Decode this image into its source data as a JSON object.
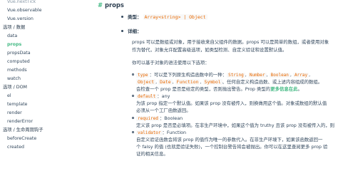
{
  "sidebar": {
    "items": [
      {
        "label": "Vue.nextTick",
        "kind": "sub",
        "state": "faded"
      },
      {
        "label": "Vue.observable",
        "kind": "sub",
        "state": "normal"
      },
      {
        "label": "Vue.version",
        "kind": "sub",
        "state": "normal"
      },
      {
        "label": "选项 / 数据",
        "kind": "section",
        "state": "normal"
      },
      {
        "label": "data",
        "kind": "sub",
        "state": "normal"
      },
      {
        "label": "props",
        "kind": "sub",
        "state": "active"
      },
      {
        "label": "propsData",
        "kind": "sub",
        "state": "normal"
      },
      {
        "label": "computed",
        "kind": "sub",
        "state": "normal"
      },
      {
        "label": "methods",
        "kind": "sub",
        "state": "normal"
      },
      {
        "label": "watch",
        "kind": "sub",
        "state": "normal"
      },
      {
        "label": "选项 / DOM",
        "kind": "section",
        "state": "normal"
      },
      {
        "label": "el",
        "kind": "sub",
        "state": "normal"
      },
      {
        "label": "template",
        "kind": "sub",
        "state": "normal"
      },
      {
        "label": "render",
        "kind": "sub",
        "state": "normal"
      },
      {
        "label": "renderError",
        "kind": "sub",
        "state": "normal"
      },
      {
        "label": "选项 / 生命周期钩子",
        "kind": "section",
        "state": "normal"
      },
      {
        "label": "beforeCreate",
        "kind": "sub",
        "state": "normal"
      },
      {
        "label": "created",
        "kind": "sub",
        "state": "normal"
      }
    ]
  },
  "main": {
    "title_hash": "#",
    "title": "props",
    "type_label": "类型：",
    "type_value": "Array<string> | Object",
    "detail_label": "详细：",
    "para1_lines": [
      "props 可以是数组或对象，用于接收来自父组件的数据。props 可以是简单的数组，或者使用对象",
      "作为替代，对象允许配置高级选项，如类型检测、自定义验证和设置默认值。"
    ],
    "para2": "你可以基于对象的语法使用以下选项：",
    "options": [
      {
        "code": "type",
        "text": "：可以是下列原生构造函数中的一种：",
        "codes": [
          "String",
          "Number",
          "Boolean",
          "Array"
        ],
        "line2_codes": [
          "Object",
          "Date",
          "Function",
          "Symbol"
        ],
        "line2_text": "、任何自定义构造函数、或上述内容组成的数组。",
        "line3_pre": "会检查一个 prop 是否是给定的类型，否则抛出警告。Prop 类型的",
        "line3_link": "更多信息在此",
        "line3_post": "。"
      },
      {
        "code": "default",
        "suffix": "：any",
        "line2": "为该 prop 指定一个默认值。如果该 prop 没有被传入，则换做用这个值。对象或数组的默认值",
        "line3": "必须从一个工厂函数返回。"
      },
      {
        "code": "required",
        "suffix": "：Boolean",
        "line2": "定义该 prop 是否是必填项。在非生产环境中，如果这个值为 truthy 且该 prop 没有被传入的，则"
      },
      {
        "code": "validator",
        "suffix": "：Function",
        "line2": "自定义验证函数会将该 prop 的值作为唯一的参数代入。在非生产环境下，如果该函数返回一",
        "line3": "个 falsy 的值 (也就是验证失败)，一个控制台警告将会被抛出。你可以在这里查阅更多 prop 验",
        "line4": "证的相关信息。"
      }
    ]
  }
}
